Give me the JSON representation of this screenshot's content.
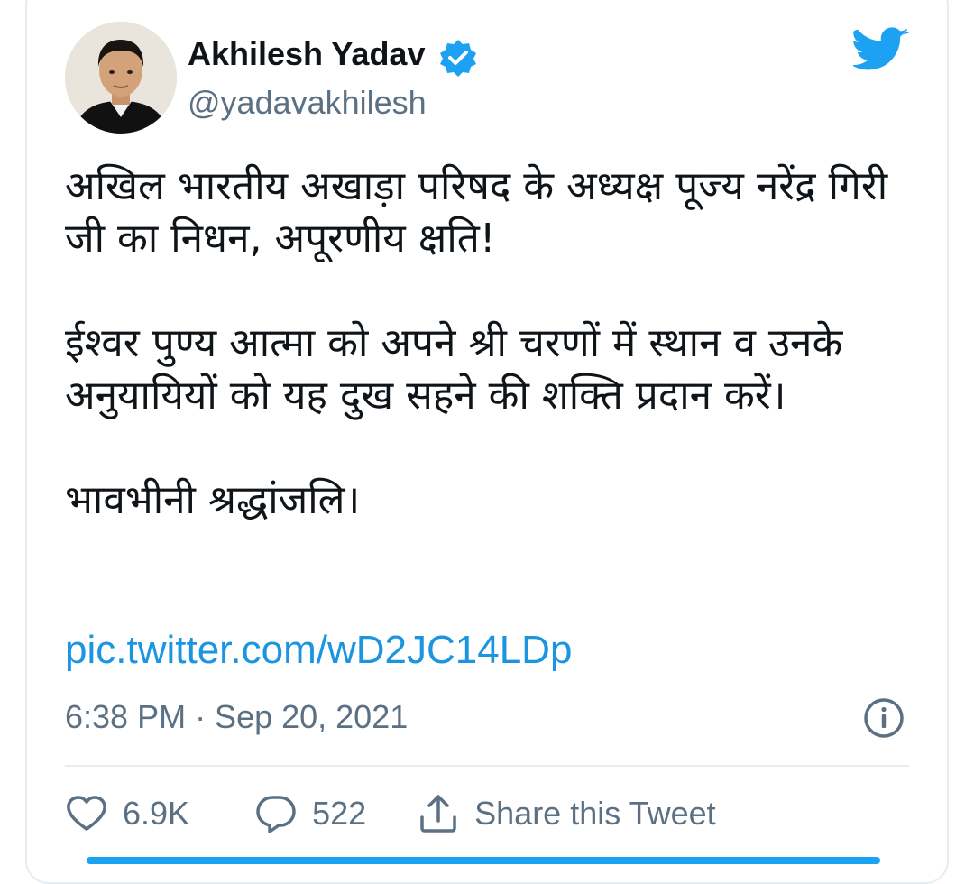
{
  "author": {
    "name": "Akhilesh Yadav",
    "handle": "@yadavakhilesh",
    "verified": true
  },
  "tweet": {
    "paragraphs": [
      "अखिल भारतीय अखाड़ा परिषद के अध्यक्ष पूज्य नरेंद्र गिरी जी का निधन, अपूरणीय क्षति!",
      "ईश्वर पुण्य आत्मा को अपने श्री चरणों में स्थान व उनके अनुयायियों को यह दुख सहने की शक्ति प्रदान करें।",
      "भावभीनी श्रद्धांजलि।"
    ],
    "link": "pic.twitter.com/wD2JC14LDp",
    "timestamp": "6:38 PM · Sep 20, 2021"
  },
  "actions": {
    "likes": "6.9K",
    "replies": "522",
    "share_label": "Share this Tweet"
  },
  "icons": {
    "verified": "verified-badge-icon",
    "brand": "twitter-bird-icon",
    "info": "info-icon",
    "like": "heart-icon",
    "reply": "reply-icon",
    "share": "share-icon"
  },
  "colors": {
    "accent": "#1da1f2",
    "link": "#1b95e0",
    "secondary_text": "#5b7083",
    "primary_text": "#0f1419",
    "border": "#e6ecf0"
  }
}
